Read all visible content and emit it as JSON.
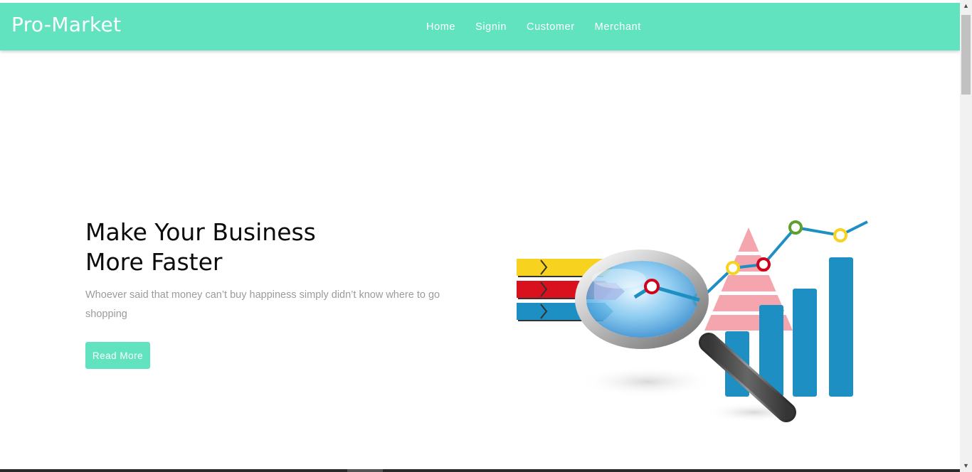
{
  "brand": {
    "name": "Pro-Market"
  },
  "nav": {
    "items": [
      {
        "label": "Home"
      },
      {
        "label": "Signin"
      },
      {
        "label": "Customer"
      },
      {
        "label": "Merchant"
      }
    ]
  },
  "hero": {
    "title_line1": "Make Your Business",
    "title_line2": "More Faster",
    "text": "Whoever said that money can’t buy happiness simply didn’t know where to go shopping",
    "button_label": "Read More"
  },
  "illustration": {
    "icon": "magnifier-growth-chart-icon"
  },
  "colors": {
    "accent": "#61e3c0",
    "bar_blue": "#1e8fc2",
    "marker_red": "#d0021b",
    "marker_yellow": "#f7d21e",
    "marker_green": "#5f9e2f",
    "pyramid_pink": "#f4a5ad"
  }
}
